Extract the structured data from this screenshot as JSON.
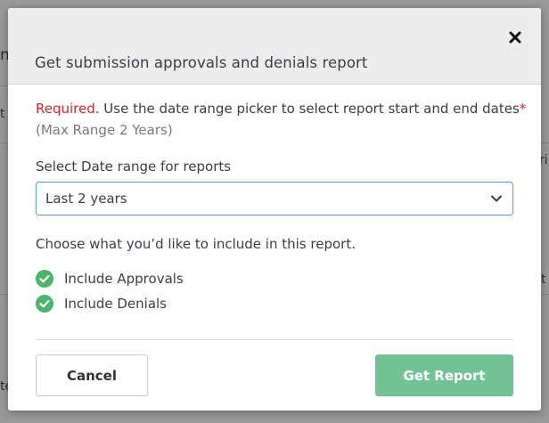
{
  "background": {
    "fragments": [
      "n",
      "t",
      "ri",
      "t",
      "te"
    ]
  },
  "modal": {
    "title": "Get submission approvals and denials report",
    "close_icon": "close-icon",
    "required_prefix": "Required.",
    "required_text": " Use the date range picker to select report start and end dates",
    "required_asterisk": "*",
    "max_range": "(Max Range 2 Years)",
    "date_range_label": "Select Date range for reports",
    "date_range_value": "Last 2 years",
    "include_heading": "Choose what you’d like to include in this report.",
    "options": [
      {
        "label": "Include Approvals",
        "checked": true
      },
      {
        "label": "Include Denials",
        "checked": true
      }
    ],
    "cancel_label": "Cancel",
    "get_report_label": "Get Report"
  },
  "colors": {
    "required_red": "#d9262b",
    "check_green": "#4cb46b",
    "primary_button": "#72c296",
    "select_border": "#6b9ee8"
  }
}
